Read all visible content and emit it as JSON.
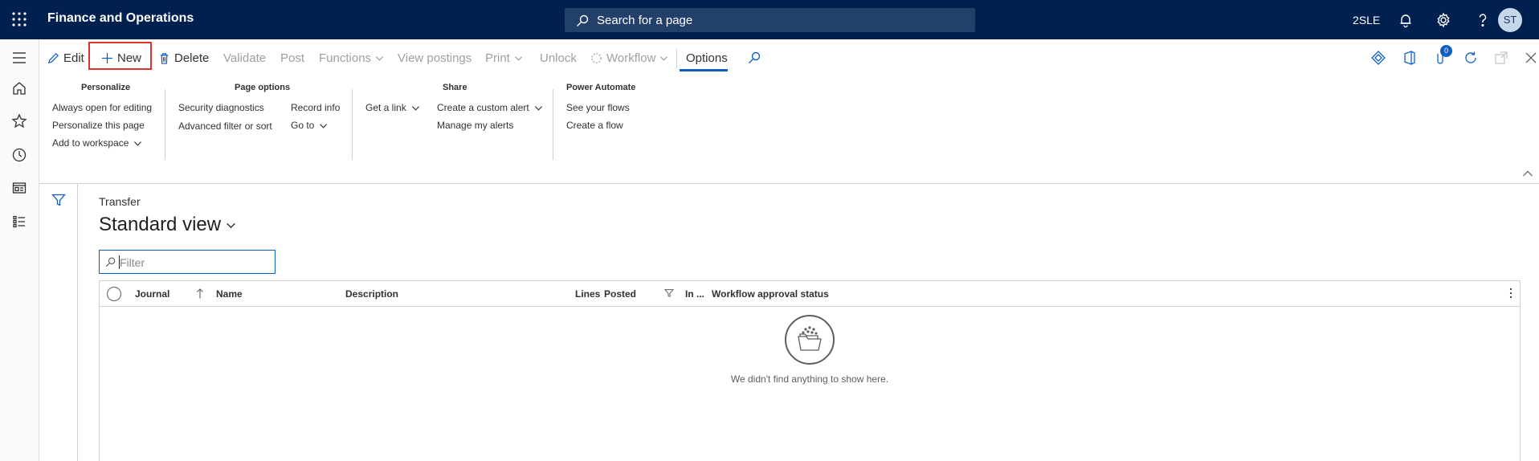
{
  "app": {
    "title": "Finance and Operations",
    "search_placeholder": "Search for a page",
    "company": "2SLE",
    "user_initials": "ST"
  },
  "actions": {
    "edit": "Edit",
    "new": "New",
    "delete": "Delete",
    "validate": "Validate",
    "post": "Post",
    "functions": "Functions",
    "view_postings": "View postings",
    "print": "Print",
    "unlock": "Unlock",
    "workflow": "Workflow",
    "options": "Options",
    "notification_count": "0"
  },
  "groups": {
    "personalize": {
      "title": "Personalize",
      "items": [
        "Always open for editing",
        "Personalize this page",
        "Add to workspace"
      ]
    },
    "page_options": {
      "title": "Page options",
      "items": [
        "Security diagnostics",
        "Advanced filter or sort",
        "Record info",
        "Go to"
      ]
    },
    "share": {
      "title": "Share",
      "items": [
        "Get a link",
        "Create a custom alert",
        "Manage my alerts"
      ]
    },
    "power_automate": {
      "title": "Power Automate",
      "items": [
        "See your flows",
        "Create a flow"
      ]
    }
  },
  "page": {
    "breadcrumb": "Transfer",
    "view_name": "Standard view",
    "filter_placeholder": "Filter"
  },
  "grid": {
    "columns": [
      "Journal",
      "Name",
      "Description",
      "Lines",
      "Posted",
      "In ...",
      "Workflow approval status"
    ],
    "empty_message": "We didn't find anything to show here."
  },
  "colors": {
    "topbar": "#002050",
    "accent": "#0f5fc2",
    "highlight": "#e03131"
  }
}
